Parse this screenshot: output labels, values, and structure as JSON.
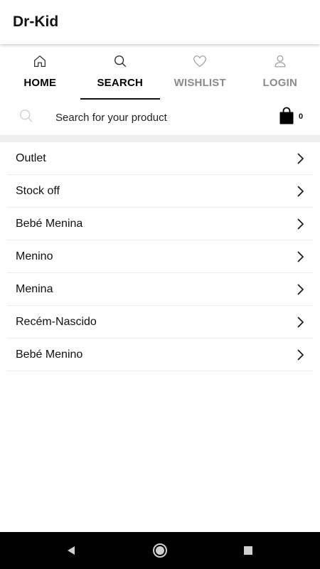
{
  "appbar": {
    "title": "Dr-Kid"
  },
  "tabs": [
    {
      "label": "HOME",
      "icon": "home-icon",
      "active": false
    },
    {
      "label": "SEARCH",
      "icon": "search-icon",
      "active": true
    },
    {
      "label": "WISHLIST",
      "icon": "heart-icon",
      "active": false
    },
    {
      "label": "LOGIN",
      "icon": "user-icon",
      "active": false
    }
  ],
  "search": {
    "placeholder": "Search for your product",
    "cart_count": "0"
  },
  "categories": [
    {
      "label": "Outlet"
    },
    {
      "label": "Stock off"
    },
    {
      "label": "Bebé Menina"
    },
    {
      "label": "Menino"
    },
    {
      "label": "Menina"
    },
    {
      "label": "Recém-Nascido"
    },
    {
      "label": "Bebé Menino"
    }
  ],
  "colors": {
    "active_tab": "#000000",
    "inactive_tab": "#8a8a8a",
    "band": "#efefef",
    "navbar": "#000000"
  }
}
